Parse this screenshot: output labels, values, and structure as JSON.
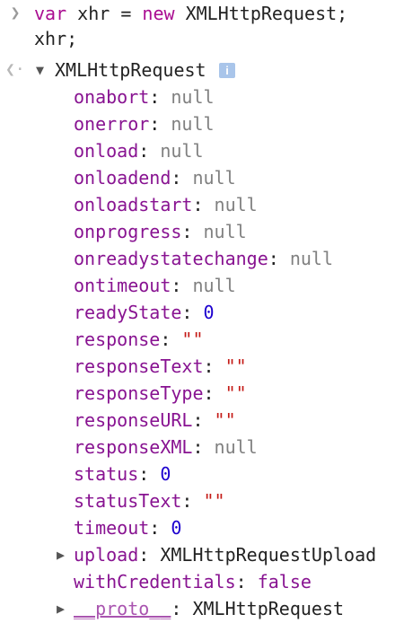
{
  "console": {
    "prompt_icon": "chevron-right-icon",
    "input_lines": [
      {
        "keyword1": "var",
        "middle": " xhr = ",
        "keyword2": "new",
        "rest": " XMLHttpRequest;"
      },
      {
        "text": "xhr;"
      }
    ],
    "result_icon": "return-arrow-icon",
    "object": {
      "name": "XMLHttpRequest",
      "expanded": true,
      "info_badge": "i",
      "properties": [
        {
          "key": "onabort",
          "value": "null",
          "type": "null"
        },
        {
          "key": "onerror",
          "value": "null",
          "type": "null"
        },
        {
          "key": "onload",
          "value": "null",
          "type": "null"
        },
        {
          "key": "onloadend",
          "value": "null",
          "type": "null"
        },
        {
          "key": "onloadstart",
          "value": "null",
          "type": "null"
        },
        {
          "key": "onprogress",
          "value": "null",
          "type": "null"
        },
        {
          "key": "onreadystatechange",
          "value": "null",
          "type": "null"
        },
        {
          "key": "ontimeout",
          "value": "null",
          "type": "null"
        },
        {
          "key": "readyState",
          "value": "0",
          "type": "number"
        },
        {
          "key": "response",
          "value": "\"\"",
          "type": "string"
        },
        {
          "key": "responseText",
          "value": "\"\"",
          "type": "string"
        },
        {
          "key": "responseType",
          "value": "\"\"",
          "type": "string"
        },
        {
          "key": "responseURL",
          "value": "\"\"",
          "type": "string"
        },
        {
          "key": "responseXML",
          "value": "null",
          "type": "null"
        },
        {
          "key": "status",
          "value": "0",
          "type": "number"
        },
        {
          "key": "statusText",
          "value": "\"\"",
          "type": "string"
        },
        {
          "key": "timeout",
          "value": "0",
          "type": "number"
        },
        {
          "key": "upload",
          "value": "XMLHttpRequestUpload",
          "type": "object",
          "expandable": true
        },
        {
          "key": "withCredentials",
          "value": "false",
          "type": "boolean"
        },
        {
          "key": "__proto__",
          "value": "XMLHttpRequest",
          "type": "proto",
          "expandable": true
        }
      ]
    }
  }
}
